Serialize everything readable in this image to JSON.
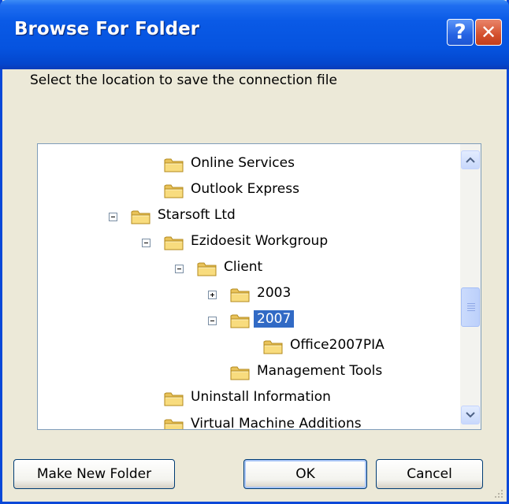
{
  "window": {
    "title": "Browse For Folder",
    "help_glyph": "?",
    "close_glyph": "✕"
  },
  "instruction": "Select the location to save the connection file",
  "tree": {
    "items": [
      {
        "label": "Online Services",
        "expander": "none"
      },
      {
        "label": "Outlook Express",
        "expander": "none"
      },
      {
        "label": "Starsoft Ltd",
        "expander": "minus"
      },
      {
        "label": "Ezidoesit Workgroup",
        "expander": "minus"
      },
      {
        "label": "Client",
        "expander": "minus"
      },
      {
        "label": "2003",
        "expander": "plus"
      },
      {
        "label": "2007",
        "expander": "minus",
        "selected": true
      },
      {
        "label": "Office2007PIA",
        "expander": "none"
      },
      {
        "label": "Management Tools",
        "expander": "none"
      },
      {
        "label": "Uninstall Information",
        "expander": "none"
      },
      {
        "label": "Virtual Machine Additions",
        "expander": "none",
        "partially_visible": true
      }
    ]
  },
  "buttons": {
    "make_new_folder": "Make New Folder",
    "ok": "OK",
    "cancel": "Cancel"
  },
  "colors": {
    "selection": "#316ac5",
    "titlebar": "#0553df",
    "dialog_bg": "#ece9d8"
  }
}
